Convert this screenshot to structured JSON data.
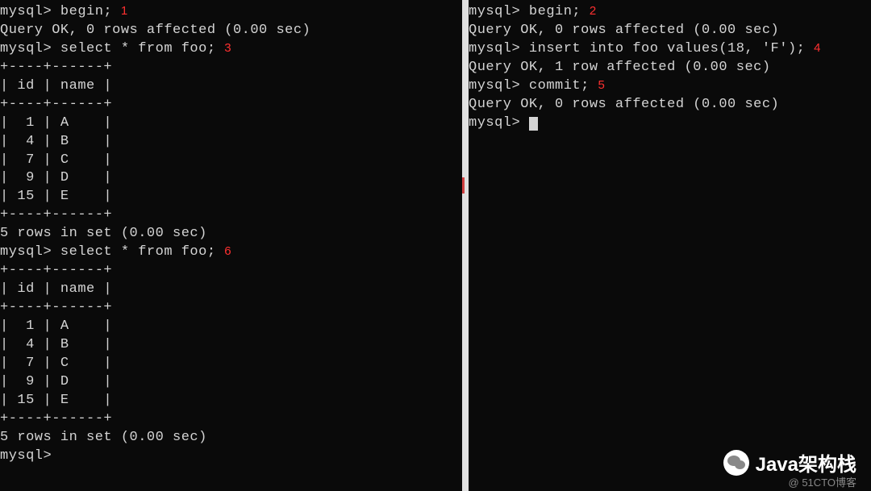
{
  "left_pane": {
    "lines": [
      {
        "text": "mysql> begin; ",
        "annotation": "1"
      },
      {
        "text": "Query OK, 0 rows affected (0.00 sec)"
      },
      {
        "text": ""
      },
      {
        "text": "mysql> select * from foo; ",
        "annotation": "3"
      },
      {
        "text": "+----+------+"
      },
      {
        "text": "| id | name |"
      },
      {
        "text": "+----+------+"
      },
      {
        "text": "|  1 | A    |"
      },
      {
        "text": "|  4 | B    |"
      },
      {
        "text": "|  7 | C    |"
      },
      {
        "text": "|  9 | D    |"
      },
      {
        "text": "| 15 | E    |"
      },
      {
        "text": "+----+------+"
      },
      {
        "text": "5 rows in set (0.00 sec)"
      },
      {
        "text": ""
      },
      {
        "text": "mysql> select * from foo; ",
        "annotation": "6"
      },
      {
        "text": "+----+------+"
      },
      {
        "text": "| id | name |"
      },
      {
        "text": "+----+------+"
      },
      {
        "text": "|  1 | A    |"
      },
      {
        "text": "|  4 | B    |"
      },
      {
        "text": "|  7 | C    |"
      },
      {
        "text": "|  9 | D    |"
      },
      {
        "text": "| 15 | E    |"
      },
      {
        "text": "+----+------+"
      },
      {
        "text": "5 rows in set (0.00 sec)"
      },
      {
        "text": ""
      },
      {
        "text": "mysql>"
      }
    ]
  },
  "right_pane": {
    "lines": [
      {
        "text": "mysql> begin; ",
        "annotation": "2"
      },
      {
        "text": "Query OK, 0 rows affected (0.00 sec)"
      },
      {
        "text": ""
      },
      {
        "text": "mysql> insert into foo values(18, 'F'); ",
        "annotation": "4"
      },
      {
        "text": "Query OK, 1 row affected (0.00 sec)"
      },
      {
        "text": ""
      },
      {
        "text": "mysql> commit; ",
        "annotation": "5"
      },
      {
        "text": "Query OK, 0 rows affected (0.00 sec)"
      },
      {
        "text": ""
      },
      {
        "text": "mysql> ",
        "cursor": true
      }
    ]
  },
  "watermark": {
    "brand": "Java架构栈",
    "source": "@ 51CTO博客"
  }
}
